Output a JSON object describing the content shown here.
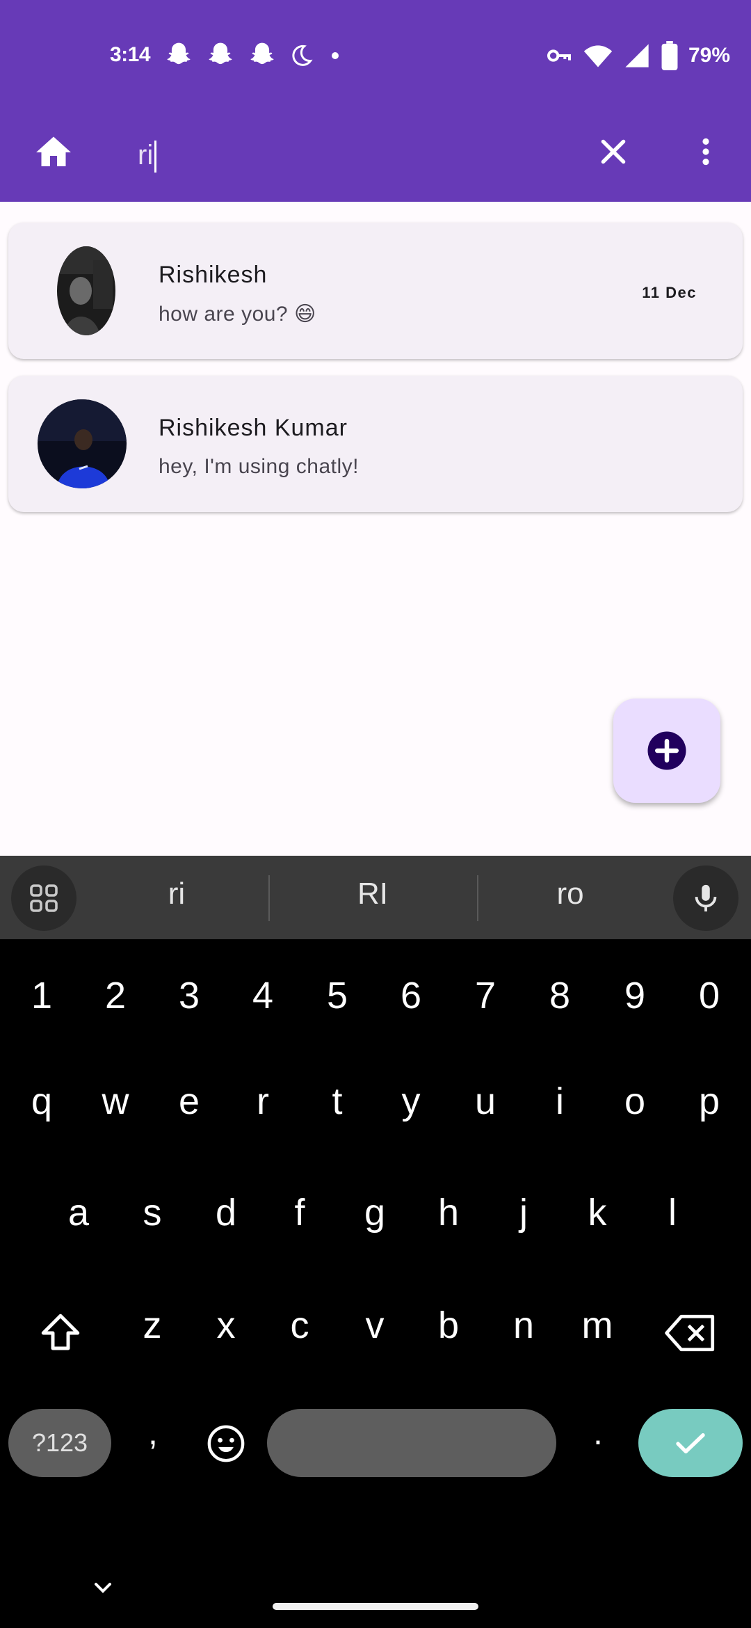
{
  "status": {
    "time": "3:14",
    "battery": "79%",
    "left_icons": [
      "snapchat-icon",
      "snapchat-icon",
      "snapchat-icon",
      "moon-icon",
      "dot-icon"
    ],
    "right_icons": [
      "key-icon",
      "wifi-icon",
      "signal-icon",
      "battery-icon"
    ]
  },
  "appbar": {
    "search_value": "ri",
    "home_icon": "home-icon",
    "clear_icon": "close-icon",
    "menu_icon": "more-vert-icon",
    "background": "#673ab7"
  },
  "chats": [
    {
      "name": "Rishikesh",
      "message": "how are you? 😄",
      "date": "11 Dec"
    },
    {
      "name": "Rishikesh Kumar",
      "message": "hey, I'm using chatly!",
      "date": ""
    }
  ],
  "fab": {
    "icon": "add-circle-icon",
    "background": "#eaddff"
  },
  "keyboard": {
    "suggestions": [
      "ri",
      "RI",
      "ro"
    ],
    "number_row": [
      "1",
      "2",
      "3",
      "4",
      "5",
      "6",
      "7",
      "8",
      "9",
      "0"
    ],
    "row1": [
      "q",
      "w",
      "e",
      "r",
      "t",
      "y",
      "u",
      "i",
      "o",
      "p"
    ],
    "row2": [
      "a",
      "s",
      "d",
      "f",
      "g",
      "h",
      "j",
      "k",
      "l"
    ],
    "row3": [
      "z",
      "x",
      "c",
      "v",
      "b",
      "n",
      "m"
    ],
    "symbols_label": "?123",
    "comma": ",",
    "period": ".",
    "enter_color": "#78cbc0"
  }
}
